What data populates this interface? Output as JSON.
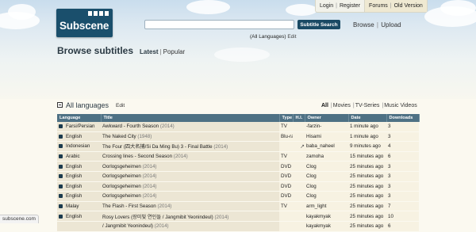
{
  "header": {
    "logo_text": "Subscene",
    "top_links": {
      "login": "Login",
      "register": "Register",
      "forums": "Forums",
      "old_version": "Old Version"
    },
    "search_value": "",
    "search_button": "Subtitle Search",
    "browse": "Browse",
    "upload": "Upload",
    "language_filter": "(All Languages)",
    "language_filter_edit": "Edit"
  },
  "page": {
    "title": "Browse subtitles",
    "tab_latest": "Latest",
    "tab_popular": "Popular"
  },
  "section": {
    "title": "All languages",
    "edit": "Edit",
    "filters": {
      "all": "All",
      "movies": "Movies",
      "tv_series": "TV-Series",
      "music_videos": "Music Videos"
    }
  },
  "table": {
    "headers": [
      "Language",
      "Title",
      "Type",
      "H.I.",
      "Owner",
      "Date",
      "Downloads"
    ],
    "rows": [
      {
        "language": "Farsi/Persian",
        "title": "Awkward - Fourth Season",
        "year": "(2014)",
        "type": "TV",
        "hi": "",
        "owner": "-farzin-",
        "date": "1 minute ago",
        "downloads": "3"
      },
      {
        "language": "English",
        "title": "The Naked City",
        "year": "(1948)",
        "type": "Blu-ray",
        "hi": "",
        "owner": "Hisami",
        "date": "1 minute ago",
        "downloads": "3"
      },
      {
        "language": "Indonesian",
        "title": "The Four (四大名捕/Si Da Ming Bu) 3 - Final Battle",
        "year": "(2014)",
        "type": "",
        "hi": "ear-icon",
        "owner": "baba_naheel",
        "date": "9 minutes ago",
        "downloads": "4"
      },
      {
        "language": "Arabic",
        "title": "Crossing lines - Second Season",
        "year": "(2014)",
        "type": "TV",
        "hi": "",
        "owner": "zamoha",
        "date": "15 minutes ago",
        "downloads": "6"
      },
      {
        "language": "English",
        "title": "Oorlogsgeheimen",
        "year": "(2014)",
        "type": "DVD",
        "hi": "",
        "owner": "Clog",
        "date": "25 minutes ago",
        "downloads": "3"
      },
      {
        "language": "English",
        "title": "Oorlogsgeheimen",
        "year": "(2014)",
        "type": "DVD",
        "hi": "",
        "owner": "Clog",
        "date": "25 minutes ago",
        "downloads": "3"
      },
      {
        "language": "English",
        "title": "Oorlogsgeheimen",
        "year": "(2014)",
        "type": "DVD",
        "hi": "",
        "owner": "Clog",
        "date": "25 minutes ago",
        "downloads": "3"
      },
      {
        "language": "English",
        "title": "Oorlogsgeheimen",
        "year": "(2014)",
        "type": "DVD",
        "hi": "",
        "owner": "Clog",
        "date": "25 minutes ago",
        "downloads": "3"
      },
      {
        "language": "Malay",
        "title": "The Flash - First Season",
        "year": "(2014)",
        "type": "TV",
        "hi": "",
        "owner": "arm_light",
        "date": "25 minutes ago",
        "downloads": "7"
      },
      {
        "language": "English",
        "title": "Rosy Lovers (장미빛 연인들 / Jangmibit Yeonindeul)",
        "year": "(2014)",
        "type": "",
        "hi": "",
        "owner": "kayakmyak",
        "date": "25 minutes ago",
        "downloads": "10"
      },
      {
        "language": "",
        "title": "/ Jangmibit Yeonindeul)",
        "year": "(2014)",
        "type": "",
        "hi": "",
        "owner": "kayakmyak",
        "date": "25 minutes ago",
        "downloads": "6"
      }
    ]
  },
  "status_bar": "subscene.com",
  "colors": {
    "logo_bg": "#1a4f6c",
    "table_header": "#4e7184",
    "search_button": "#1a4a64"
  }
}
